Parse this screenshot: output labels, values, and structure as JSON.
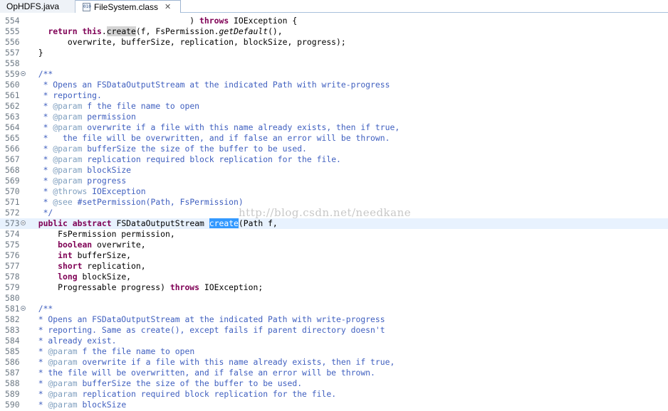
{
  "tabs": [
    {
      "label": "OpHDFS.java",
      "active": false
    },
    {
      "label": "FileSystem.class",
      "active": true
    }
  ],
  "tab_icons": [
    "class-file-icon",
    "close-icon"
  ],
  "watermark": "http://blog.csdn.net/needkane",
  "colors": {
    "keyword": "#7f0055",
    "comment": "#3f5fbf",
    "javadoc_tag": "#7f9fbf",
    "selection": "#3399ff",
    "current_line": "#e8f2fe"
  },
  "lines": [
    {
      "n": "554",
      "t": "                                 ) throws IOException {"
    },
    {
      "n": "555",
      "t": "    return this.create(f, FsPermission.getDefault(),"
    },
    {
      "n": "556",
      "t": "        overwrite, bufferSize, replication, blockSize, progress);"
    },
    {
      "n": "557",
      "t": "  }"
    },
    {
      "n": "558",
      "t": ""
    },
    {
      "n": "559",
      "t": "  /**",
      "fold": true
    },
    {
      "n": "560",
      "t": "   * Opens an FSDataOutputStream at the indicated Path with write-progress"
    },
    {
      "n": "561",
      "t": "   * reporting."
    },
    {
      "n": "562",
      "t": "   * @param f the file name to open"
    },
    {
      "n": "563",
      "t": "   * @param permission"
    },
    {
      "n": "564",
      "t": "   * @param overwrite if a file with this name already exists, then if true,"
    },
    {
      "n": "565",
      "t": "   *   the file will be overwritten, and if false an error will be thrown."
    },
    {
      "n": "566",
      "t": "   * @param bufferSize the size of the buffer to be used."
    },
    {
      "n": "567",
      "t": "   * @param replication required block replication for the file."
    },
    {
      "n": "568",
      "t": "   * @param blockSize"
    },
    {
      "n": "569",
      "t": "   * @param progress"
    },
    {
      "n": "570",
      "t": "   * @throws IOException"
    },
    {
      "n": "571",
      "t": "   * @see #setPermission(Path, FsPermission)"
    },
    {
      "n": "572",
      "t": "   */"
    },
    {
      "n": "573",
      "t": "  public abstract FSDataOutputStream create(Path f,",
      "fold": true,
      "current": true
    },
    {
      "n": "574",
      "t": "      FsPermission permission,"
    },
    {
      "n": "575",
      "t": "      boolean overwrite,"
    },
    {
      "n": "576",
      "t": "      int bufferSize,"
    },
    {
      "n": "577",
      "t": "      short replication,"
    },
    {
      "n": "578",
      "t": "      long blockSize,"
    },
    {
      "n": "579",
      "t": "      Progressable progress) throws IOException;"
    },
    {
      "n": "580",
      "t": ""
    },
    {
      "n": "581",
      "t": "  /**",
      "fold": true
    },
    {
      "n": "582",
      "t": "  * Opens an FSDataOutputStream at the indicated Path with write-progress"
    },
    {
      "n": "583",
      "t": "  * reporting. Same as create(), except fails if parent directory doesn't"
    },
    {
      "n": "584",
      "t": "  * already exist."
    },
    {
      "n": "585",
      "t": "  * @param f the file name to open"
    },
    {
      "n": "586",
      "t": "  * @param overwrite if a file with this name already exists, then if true,"
    },
    {
      "n": "587",
      "t": "  * the file will be overwritten, and if false an error will be thrown."
    },
    {
      "n": "588",
      "t": "  * @param bufferSize the size of the buffer to be used."
    },
    {
      "n": "589",
      "t": "  * @param replication required block replication for the file."
    },
    {
      "n": "590",
      "t": "  * @param blockSize"
    }
  ]
}
